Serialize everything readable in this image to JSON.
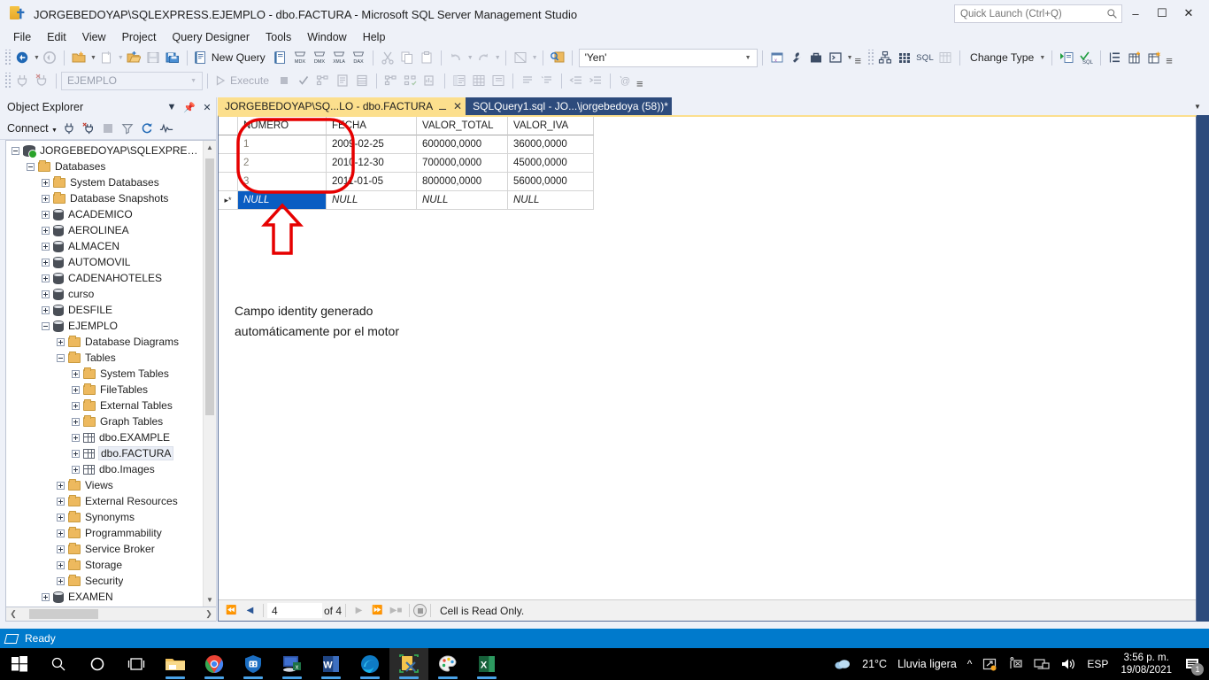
{
  "window": {
    "title": "JORGEBEDOYAP\\SQLEXPRESS.EJEMPLO - dbo.FACTURA - Microsoft SQL Server Management Studio",
    "minimize_label": "–",
    "maximize_label": "☐",
    "close_label": "✕"
  },
  "quick_launch": {
    "placeholder": "Quick Launch (Ctrl+Q)",
    "value": ""
  },
  "menu": {
    "items": [
      "File",
      "Edit",
      "View",
      "Project",
      "Query Designer",
      "Tools",
      "Window",
      "Help"
    ]
  },
  "toolbar1": {
    "new_query_label": "New Query",
    "buttons": [
      "connect-object-explorer",
      "new-project",
      "open-file",
      "new-folder",
      "save",
      "save-all",
      "new-query",
      "new-analysis-query",
      "new-mdx-query",
      "new-dmx-query",
      "new-xmla-query",
      "new-dax-query",
      "cut",
      "copy",
      "paste",
      "undo",
      "redo",
      "toggle-panel",
      "find"
    ],
    "mdx_label": "MDX",
    "dmx_label": "DMX",
    "xmla_label": "XMLA",
    "dax_label": "DAX"
  },
  "toolbar2": {
    "database_combo": {
      "value": "EJEMPLO",
      "disabled": true
    },
    "execute_label": "Execute",
    "yen_combo": {
      "value": "'Yen'"
    },
    "change_type_label": "Change Type",
    "sql_label": "SQL"
  },
  "object_explorer": {
    "title": "Object Explorer",
    "connect_label": "Connect",
    "toolbar_icons": [
      "connect-icon",
      "disconnect-icon",
      "stop-icon",
      "filter-icon",
      "refresh-icon",
      "activity-monitor-icon"
    ],
    "tree": [
      {
        "label": "JORGEBEDOYAP\\SQLEXPRESS (S",
        "indent": 0,
        "state": "minus",
        "icon": "server-icon"
      },
      {
        "label": "Databases",
        "indent": 1,
        "state": "minus",
        "icon": "folder-icon"
      },
      {
        "label": "System Databases",
        "indent": 2,
        "state": "plus",
        "icon": "folder-icon"
      },
      {
        "label": "Database Snapshots",
        "indent": 2,
        "state": "plus",
        "icon": "folder-icon"
      },
      {
        "label": "ACADEMICO",
        "indent": 2,
        "state": "plus",
        "icon": "database-icon"
      },
      {
        "label": "AEROLINEA",
        "indent": 2,
        "state": "plus",
        "icon": "database-icon"
      },
      {
        "label": "ALMACEN",
        "indent": 2,
        "state": "plus",
        "icon": "database-icon"
      },
      {
        "label": "AUTOMOVIL",
        "indent": 2,
        "state": "plus",
        "icon": "database-icon"
      },
      {
        "label": "CADENAHOTELES",
        "indent": 2,
        "state": "plus",
        "icon": "database-icon"
      },
      {
        "label": "curso",
        "indent": 2,
        "state": "plus",
        "icon": "database-icon"
      },
      {
        "label": "DESFILE",
        "indent": 2,
        "state": "plus",
        "icon": "database-icon"
      },
      {
        "label": "EJEMPLO",
        "indent": 2,
        "state": "minus",
        "icon": "database-icon"
      },
      {
        "label": "Database Diagrams",
        "indent": 3,
        "state": "plus",
        "icon": "folder-icon"
      },
      {
        "label": "Tables",
        "indent": 3,
        "state": "minus",
        "icon": "folder-icon"
      },
      {
        "label": "System Tables",
        "indent": 4,
        "state": "plus",
        "icon": "folder-icon"
      },
      {
        "label": "FileTables",
        "indent": 4,
        "state": "plus",
        "icon": "folder-icon"
      },
      {
        "label": "External Tables",
        "indent": 4,
        "state": "plus",
        "icon": "folder-icon"
      },
      {
        "label": "Graph Tables",
        "indent": 4,
        "state": "plus",
        "icon": "folder-icon"
      },
      {
        "label": "dbo.EXAMPLE",
        "indent": 4,
        "state": "plus",
        "icon": "table-icon"
      },
      {
        "label": "dbo.FACTURA",
        "indent": 4,
        "state": "plus",
        "icon": "table-icon",
        "selected": true
      },
      {
        "label": "dbo.Images",
        "indent": 4,
        "state": "plus",
        "icon": "table-icon"
      },
      {
        "label": "Views",
        "indent": 3,
        "state": "plus",
        "icon": "folder-icon"
      },
      {
        "label": "External Resources",
        "indent": 3,
        "state": "plus",
        "icon": "folder-icon"
      },
      {
        "label": "Synonyms",
        "indent": 3,
        "state": "plus",
        "icon": "folder-icon"
      },
      {
        "label": "Programmability",
        "indent": 3,
        "state": "plus",
        "icon": "folder-icon"
      },
      {
        "label": "Service Broker",
        "indent": 3,
        "state": "plus",
        "icon": "folder-icon"
      },
      {
        "label": "Storage",
        "indent": 3,
        "state": "plus",
        "icon": "folder-icon"
      },
      {
        "label": "Security",
        "indent": 3,
        "state": "plus",
        "icon": "folder-icon"
      },
      {
        "label": "EXAMEN",
        "indent": 2,
        "state": "plus",
        "icon": "database-icon"
      }
    ]
  },
  "tabs": [
    {
      "label": "JORGEBEDOYAP\\SQ...LO - dbo.FACTURA",
      "active": true,
      "pinned": true
    },
    {
      "label": "SQLQuery1.sql - JO...\\jorgebedoya (58))*",
      "active": false
    }
  ],
  "grid": {
    "columns": [
      "NUMERO",
      "FECHA",
      "VALOR_TOTAL",
      "VALOR_IVA"
    ],
    "rows": [
      {
        "NUMERO": "1",
        "FECHA": "2009-02-25",
        "VALOR_TOTAL": "600000,0000",
        "VALOR_IVA": "36000,0000"
      },
      {
        "NUMERO": "2",
        "FECHA": "2010-12-30",
        "VALOR_TOTAL": "700000,0000",
        "VALOR_IVA": "45000,0000"
      },
      {
        "NUMERO": "3",
        "FECHA": "2011-01-05",
        "VALOR_TOTAL": "800000,0000",
        "VALOR_IVA": "56000,0000"
      }
    ],
    "new_row": {
      "marker": "▸*",
      "NUMERO": "NULL",
      "FECHA": "NULL",
      "VALOR_TOTAL": "NULL",
      "VALOR_IVA": "NULL"
    }
  },
  "annotation": {
    "text": "Campo identity generado\nautomáticamente por el motor",
    "color": "#e60000"
  },
  "grid_nav": {
    "current": "4",
    "of_label": "of 4",
    "message": "Cell is Read Only."
  },
  "status_bar": {
    "text": "Ready"
  },
  "taskbar": {
    "items": [
      "start-button",
      "search-icon",
      "cortana-icon",
      "task-view-icon",
      "file-explorer-icon",
      "chrome-icon",
      "security-icon",
      "remote-desktop-icon",
      "word-icon",
      "edge-icon",
      "ssms-icon",
      "paint-icon",
      "excel-icon"
    ],
    "weather": {
      "temperature": "21°C",
      "condition": "Lluvia ligera"
    },
    "language": "ESP",
    "time": "3:56 p. m.",
    "date": "19/08/2021",
    "notification_count": "1"
  }
}
